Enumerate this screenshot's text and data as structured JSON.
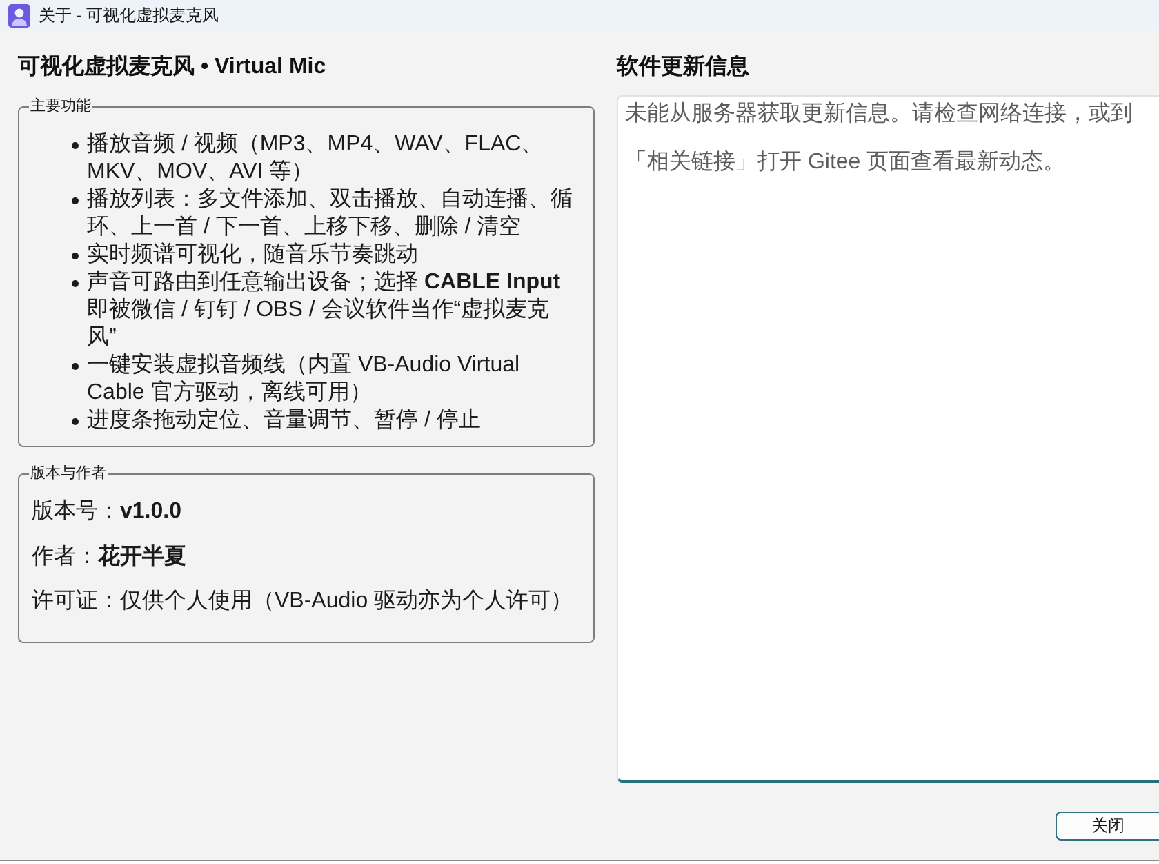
{
  "window": {
    "title": "关于 - 可视化虚拟麦克风"
  },
  "heading": "可视化虚拟麦克风 • Virtual Mic",
  "features": {
    "title": "主要功能",
    "items": [
      {
        "lines": [
          "播放音频 / 视频（MP3、MP4、WAV、FLAC、",
          "MKV、MOV、AVI 等）"
        ]
      },
      {
        "lines": [
          "播放列表：多文件添加、双击播放、自动连播、循",
          "环、上一首 / 下一首、上移下移、删除 / 清空"
        ]
      },
      {
        "lines": [
          "实时频谱可视化，随音乐节奏跳动"
        ]
      },
      {
        "lines": [
          "声音可路由到任意输出设备；选择 **CABLE Input**",
          "即被微信 / 钉钉 / OBS / 会议软件当作“虚拟麦克",
          "风”"
        ]
      },
      {
        "lines": [
          "一键安装虚拟音频线（内置 VB-Audio Virtual",
          "Cable 官方驱动，离线可用）"
        ]
      },
      {
        "lines": [
          "进度条拖动定位、音量调节、暂停 / 停止"
        ]
      }
    ]
  },
  "about": {
    "title": "版本与作者",
    "lines": [
      "版本号：**v1.0.0**",
      "作者：**花开半夏**",
      "许可证：仅供个人使用（VB-Audio 驱动亦为个人许可）"
    ]
  },
  "update": {
    "title": "软件更新信息",
    "message_lines": [
      "未能从服务器获取更新信息。请检查网络连接，或到",
      "「相关链接」打开 Gitee 页面查看最新动态。"
    ]
  },
  "close_button": {
    "label": "关闭"
  }
}
